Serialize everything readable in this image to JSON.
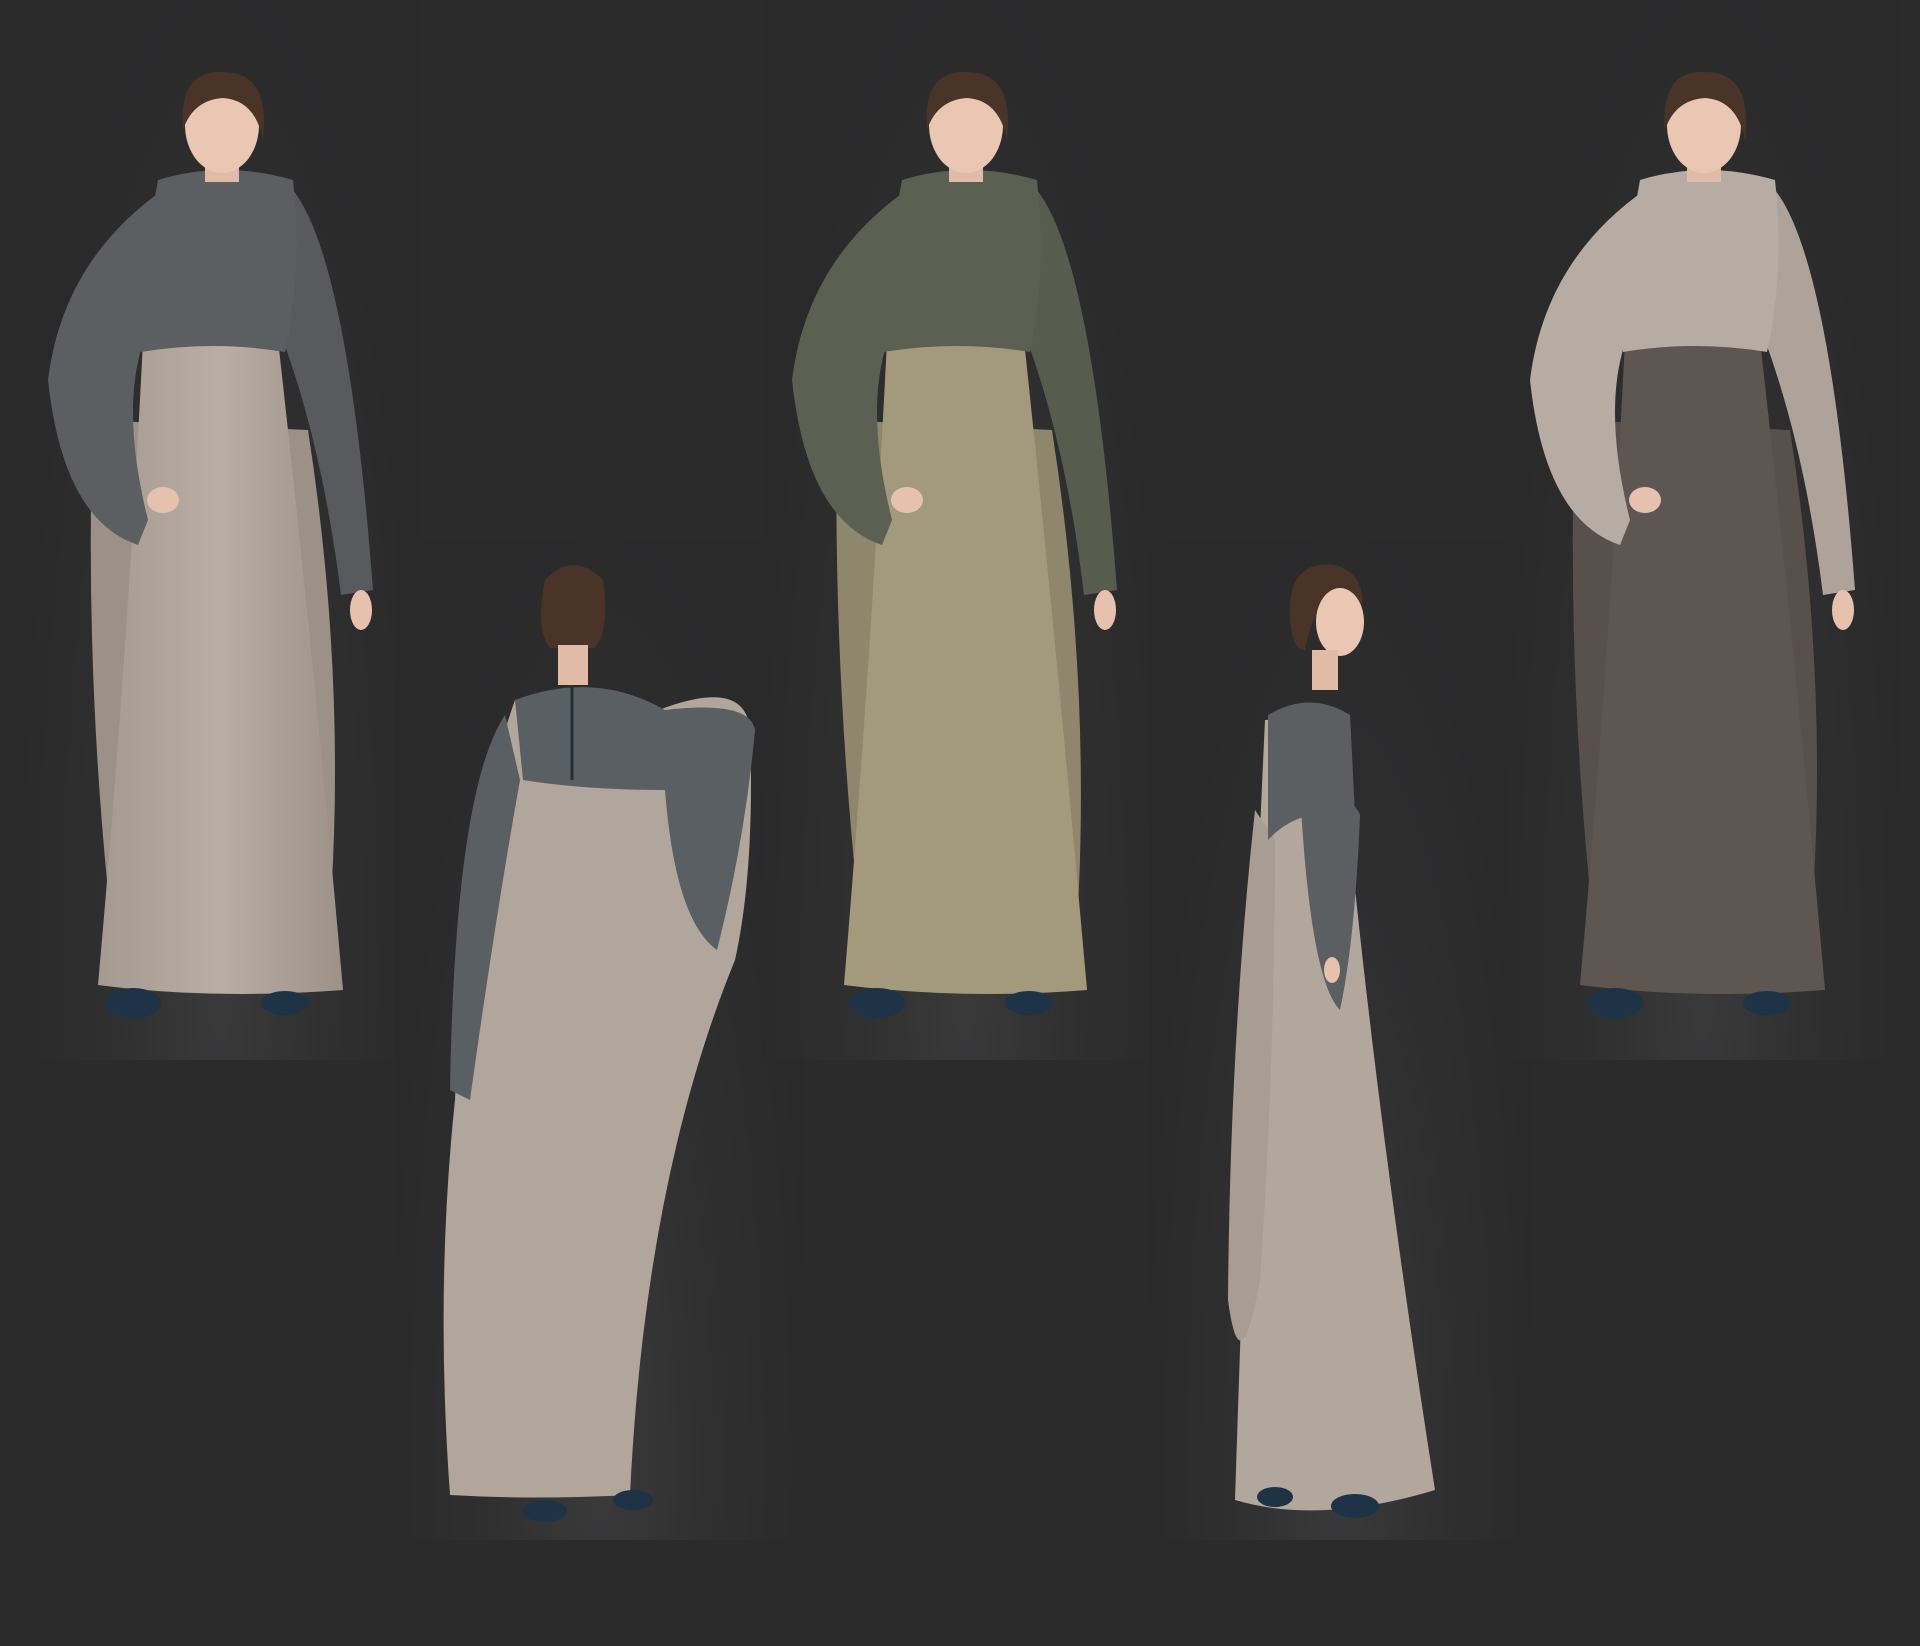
{
  "figures": [
    {
      "view": "front",
      "yoke_color": "#5b5f62",
      "body_color": "#b3a89e",
      "shoe_color": "#1f3346"
    },
    {
      "view": "back",
      "yoke_color": "#5a5f63",
      "body_color": "#b1a69c",
      "shoe_color": "#1f3346"
    },
    {
      "view": "front",
      "yoke_color": "#5c6052",
      "body_color": "#a39a7e",
      "shoe_color": "#1f3346"
    },
    {
      "view": "side",
      "yoke_color": "#5b5f62",
      "body_color": "#b2a79d",
      "shoe_color": "#1f3346"
    },
    {
      "view": "front",
      "yoke_color": "#b7aca4",
      "body_color": "#5e5651",
      "shoe_color": "#1f3346"
    }
  ],
  "colors": {
    "background": "#2b2b2c",
    "skin": "#e9c7b3",
    "hair": "#4a3428"
  }
}
